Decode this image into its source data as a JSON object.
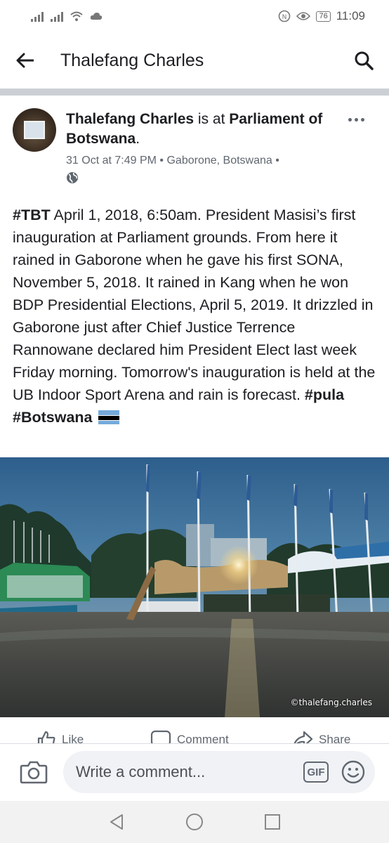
{
  "status_bar": {
    "battery": "76",
    "time": "11:09"
  },
  "header": {
    "title": "Thalefang Charles",
    "back_icon": "arrow-left-icon",
    "search_icon": "search-icon"
  },
  "post": {
    "author": "Thalefang Charles",
    "is_at_text": " is at ",
    "place": "Parliament of Botswana",
    "period": ".",
    "timestamp": "31 Oct at 7:49 PM",
    "location": "Gaborone, Botswana",
    "separator": "•",
    "privacy_icon": "globe-icon",
    "body_parts": [
      {
        "text": "#TBT",
        "bold": true
      },
      {
        "text": " April 1, 2018, 6:50am. President Masisi’s first inauguration at Parliament grounds. From here it rained in Gaborone when he gave his first SONA, November 5, 2018. It rained in Kang when he won BDP Presidential Elections, April 5, 2019. It drizzled in Gaborone just after Chief Justice Terrence Rannowane declared him President Elect last week Friday morning. Tomorrow's inauguration is held at the UB Indoor Sport Arena and rain is forecast. ",
        "bold": false
      },
      {
        "text": "#pula",
        "bold": true
      },
      {
        "text": " ",
        "bold": false
      },
      {
        "text": "#Botswana",
        "bold": true
      }
    ],
    "flag_icon": "botswana-flag-icon",
    "photo_watermark": "©thalefang.charles"
  },
  "actions": {
    "like": "Like",
    "comment": "Comment",
    "share": "Share"
  },
  "comment_bar": {
    "placeholder": "Write a comment...",
    "gif_label": "GIF"
  }
}
